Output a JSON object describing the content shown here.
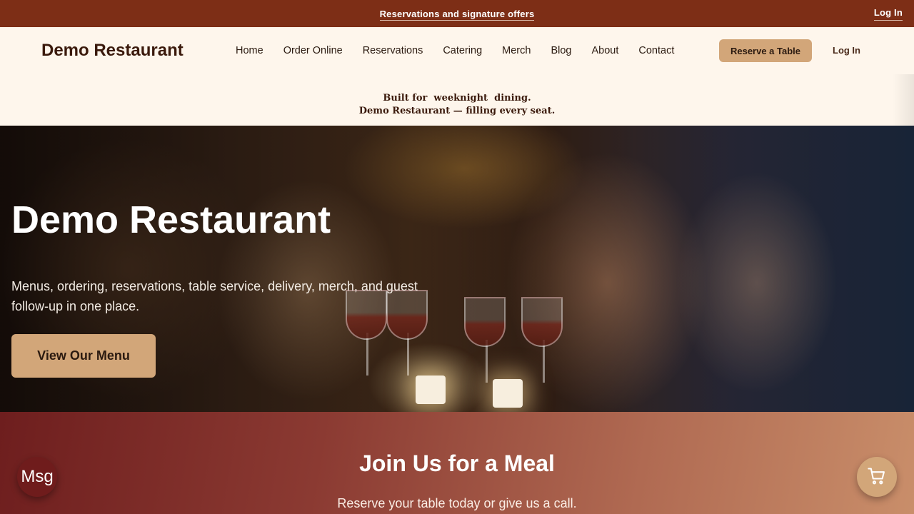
{
  "topbar": {
    "promo_link": "Reservations and signature offers",
    "login": "Log In"
  },
  "nav": {
    "brand": "Demo Restaurant",
    "links": [
      "Home",
      "Order Online",
      "Reservations",
      "Catering",
      "Merch",
      "Blog",
      "About",
      "Contact"
    ],
    "reserve_button": "Reserve a Table",
    "login": "Log In"
  },
  "tagline": {
    "line1": "Built for  weeknight  dining.",
    "line2": "Demo Restaurant — filling every seat."
  },
  "hero": {
    "title": "Demo Restaurant",
    "subtitle": "Menus, ordering, reservations, table service, delivery, merch, and guest follow-up in one place.",
    "cta": "View Our Menu"
  },
  "join": {
    "title": "Join Us for a Meal",
    "subtitle": "Reserve your table today or give us a call."
  },
  "floating": {
    "msg_button": "Msg",
    "cart_icon": "cart-icon"
  },
  "colors": {
    "topbar": "#7d2e16",
    "background": "#fef6ec",
    "accent": "#d2a679",
    "brand_text": "#3b1a0c",
    "msg_button": "#6f1c1c"
  }
}
